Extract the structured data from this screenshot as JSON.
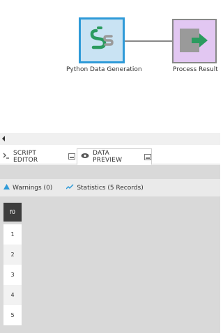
{
  "canvas": {
    "nodes": [
      {
        "label": "Python Data Generation",
        "icon": "python-icon",
        "color": "#c9e3f3",
        "border": "#2e9ad8"
      },
      {
        "label": "Process Result",
        "icon": "export-icon",
        "color": "#e2c7f2",
        "border": "#888888"
      }
    ]
  },
  "tabs": [
    {
      "label": "SCRIPT EDITOR",
      "icon": "script-icon"
    },
    {
      "label": "DATA PREVIEW",
      "icon": "eye-icon",
      "selected": true
    }
  ],
  "subtoolbar": {
    "warnings": "Warnings (0)",
    "statistics": "Statistics (5 Records)"
  },
  "table": {
    "columns": [
      "f0"
    ],
    "rows": [
      "1",
      "2",
      "3",
      "4",
      "5"
    ]
  },
  "colors": {
    "accent": "#2e9ad8",
    "python_green": "#2b9b5f",
    "header_bg": "#3d3d3d"
  }
}
